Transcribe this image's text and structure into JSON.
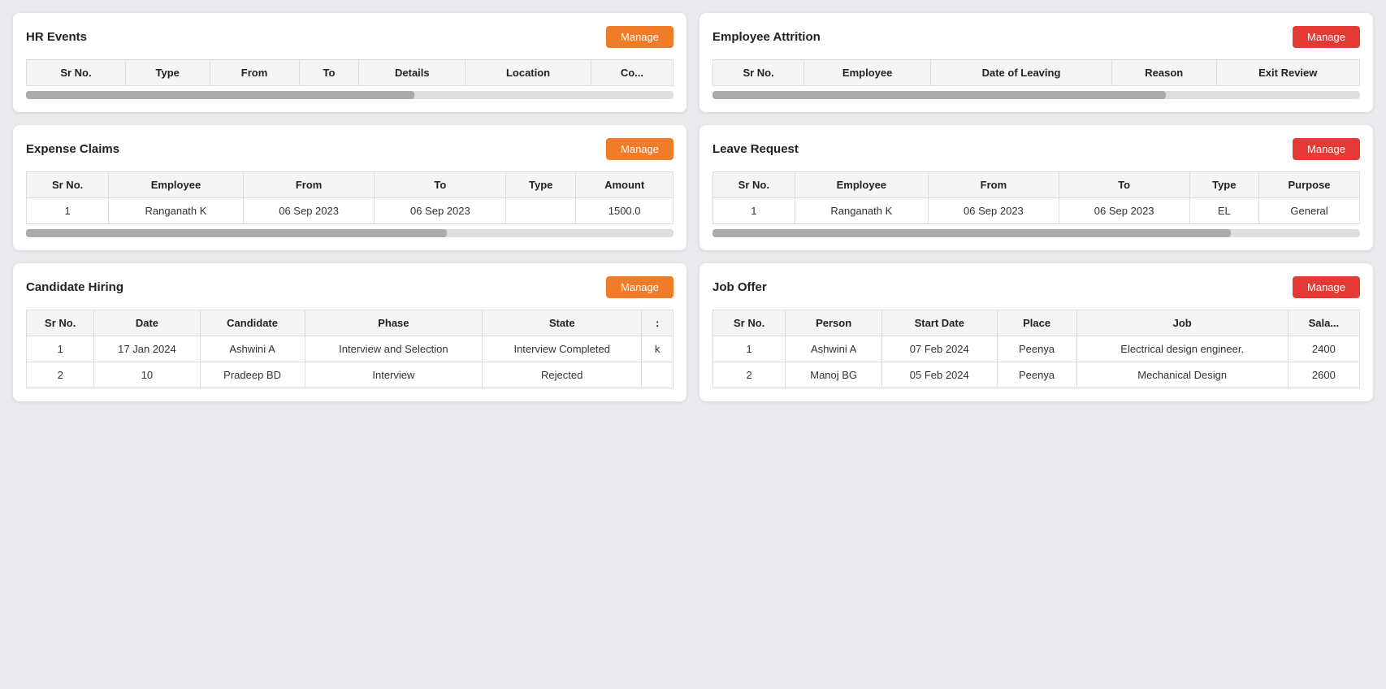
{
  "sections": {
    "hr_events": {
      "title": "HR Events",
      "btn_label": "Manage",
      "btn_type": "orange",
      "columns": [
        "Sr No.",
        "Type",
        "From",
        "To",
        "Details",
        "Location",
        "Co..."
      ],
      "rows": []
    },
    "employee_attrition": {
      "title": "Employee Attrition",
      "btn_label": "Manage",
      "btn_type": "red",
      "columns": [
        "Sr No.",
        "Employee",
        "Date of Leaving",
        "Reason",
        "Exit Review"
      ],
      "rows": []
    },
    "expense_claims": {
      "title": "Expense Claims",
      "btn_label": "Manage",
      "btn_type": "orange",
      "columns": [
        "Sr No.",
        "Employee",
        "From",
        "To",
        "Type",
        "Amount"
      ],
      "rows": [
        [
          "1",
          "Ranganath K",
          "06 Sep 2023",
          "06 Sep 2023",
          "",
          "1500.0"
        ]
      ]
    },
    "leave_request": {
      "title": "Leave Request",
      "btn_label": "Manage",
      "btn_type": "red",
      "columns": [
        "Sr No.",
        "Employee",
        "From",
        "To",
        "Type",
        "Purpose"
      ],
      "rows": [
        [
          "1",
          "Ranganath K",
          "06 Sep 2023",
          "06 Sep 2023",
          "EL",
          "General"
        ]
      ]
    },
    "candidate_hiring": {
      "title": "Candidate Hiring",
      "btn_label": "Manage",
      "btn_type": "orange",
      "columns": [
        "Sr No.",
        "Date",
        "Candidate",
        "Phase",
        "State",
        "..."
      ],
      "rows": [
        [
          "1",
          "17 Jan 2024",
          "Ashwini A",
          "Interview and Selection",
          "Interview Completed",
          "k"
        ],
        [
          "2",
          "10",
          "Pradeep BD",
          "Interview",
          "Rejected",
          ""
        ]
      ]
    },
    "job_offer": {
      "title": "Job Offer",
      "btn_label": "Manage",
      "btn_type": "red",
      "columns": [
        "Sr No.",
        "Person",
        "Start Date",
        "Place",
        "Job",
        "Sala..."
      ],
      "rows": [
        [
          "1",
          "Ashwini A",
          "07 Feb 2024",
          "Peenya",
          "Electrical design engineer.",
          "2400"
        ],
        [
          "2",
          "Manoj BG",
          "05 Feb 2024",
          "Peenya",
          "Mechanical Design",
          "2600"
        ]
      ]
    }
  }
}
